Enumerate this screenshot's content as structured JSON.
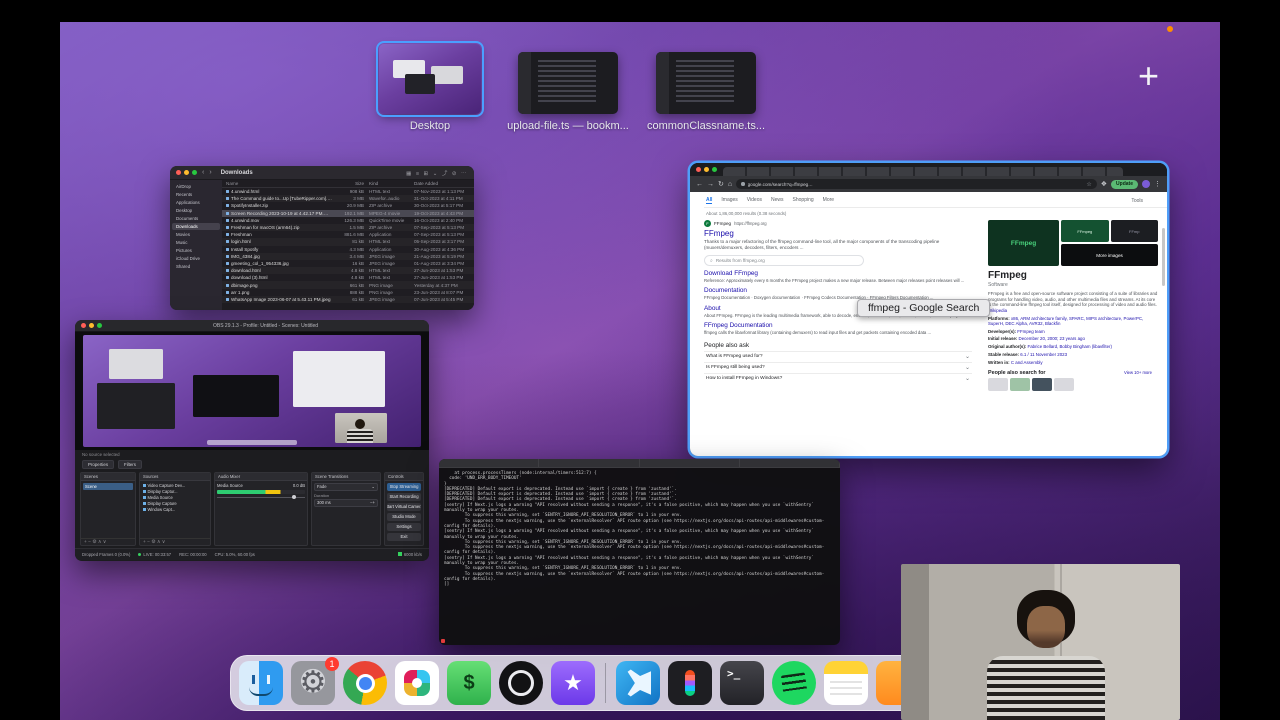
{
  "spaces": {
    "items": [
      {
        "id": "desktop",
        "label": "Desktop",
        "selected": true
      },
      {
        "id": "editor1",
        "label": "upload-file.ts — bookm...",
        "selected": false
      },
      {
        "id": "editor2",
        "label": "commonClassname.ts...",
        "selected": false
      }
    ],
    "add_label": "+"
  },
  "finder": {
    "title": "Downloads",
    "toolbar_icons": "▦ ≡ ⊞ ⌄ ⤴ ⊘ ⋯",
    "sidebar": [
      "AirDrop",
      "Recents",
      "Applications",
      "Desktop",
      "Documents",
      "Downloads",
      "Movies",
      "Music",
      "Pictures",
      "iCloud Drive",
      "Shared"
    ],
    "columns": [
      "Name",
      "Size",
      "Kind",
      "Date Added"
    ],
    "rows": [
      {
        "name": "4.unwind.html",
        "size": "908 kB",
        "kind": "HTML text",
        "date": "07-Nov-2023 at 1:13 PM"
      },
      {
        "name": "The Command guide to...Up [TubeRipper.com].wav",
        "size": "3 MB",
        "kind": "Wavefor..audio",
        "date": "31-Oct-2023 at 4:11 PM"
      },
      {
        "name": "SpotifyInstaller.zip",
        "size": "20.9 MB",
        "kind": "ZIP archive",
        "date": "30-Oct-2023 at 5:17 PM"
      },
      {
        "name": "Screen Recording 2023-10-19 at 4.42.17 PM.mp4",
        "size": "192.1 MB",
        "kind": "MPEG-4 movie",
        "date": "19-Oct-2023 at 4:43 PM"
      },
      {
        "name": "4.unwind.mov",
        "size": "126.3 MB",
        "kind": "QuickTime movie",
        "date": "16-Oct-2023 at 2:40 PM"
      },
      {
        "name": "Freshman for macOS (arm64).zip",
        "size": "1.5 MB",
        "kind": "ZIP archive",
        "date": "07-Sep-2023 at 5:13 PM"
      },
      {
        "name": "Freshman",
        "size": "881.6 MB",
        "kind": "Application",
        "date": "07-Sep-2023 at 5:13 PM"
      },
      {
        "name": "login.html",
        "size": "81 kB",
        "kind": "HTML text",
        "date": "05-Sep-2023 at 3:17 PM"
      },
      {
        "name": "Install Spotify",
        "size": "4.3 MB",
        "kind": "Application",
        "date": "30-Aug-2023 at 4:36 PM"
      },
      {
        "name": "IMG_4384.jpg",
        "size": "3.4 MB",
        "kind": "JPEG image",
        "date": "21-Aug-2023 at 5:19 PM"
      },
      {
        "name": "gmeeting_col_1_954336.jpg",
        "size": "16 kB",
        "kind": "JPEG image",
        "date": "01-Aug-2023 at 3:34 PM"
      },
      {
        "name": "download.html",
        "size": "4.8 kB",
        "kind": "HTML text",
        "date": "27-Jun-2023 at 1:53 PM"
      },
      {
        "name": "download (3).html",
        "size": "4.8 kB",
        "kind": "HTML text",
        "date": "27-Jun-2023 at 1:53 PM"
      },
      {
        "name": "dbimage.png",
        "size": "661 kB",
        "kind": "PNG image",
        "date": "Yesterday at 4:37 PM"
      },
      {
        "name": "arr 1.png",
        "size": "888 kB",
        "kind": "PNG image",
        "date": "23-Jun-2023 at 8:07 PM"
      },
      {
        "name": "WhatsApp Image 2023-06-07 at 5.43.11 PM.jpeg",
        "size": "61 kB",
        "kind": "JPEG image",
        "date": "07-Jun-2023 at 5:45 PM"
      }
    ]
  },
  "chrome": {
    "url": "google.com/search?q=ffmpeg…",
    "update_label": "Update",
    "tools_label": "Tools",
    "nav_tabs": [
      {
        "label": "All",
        "selected": true
      },
      {
        "label": "Images",
        "selected": false
      },
      {
        "label": "Videos",
        "selected": false
      },
      {
        "label": "News",
        "selected": false
      },
      {
        "label": "Shopping",
        "selected": false
      },
      {
        "label": "More",
        "selected": false
      }
    ],
    "stats": "About 1,86,00,000 results (0.38 seconds)",
    "main_result": {
      "favicon_letter": "F",
      "site": "FFmpeg",
      "url": "https://ffmpeg.org",
      "title": "FFmpeg",
      "snippet": "Thanks to a major refactoring of the ffmpeg command-line tool, all the major components of the transcoding pipeline (muxers/demuxers, decoders, filters, encoders ...",
      "site_search_placeholder": "Results from ffmpeg.org"
    },
    "sub_results": [
      {
        "title": "Download FFmpeg",
        "snippet": "Reference: Approximately every 6 months the FFmpeg project makes a new major release. Between major releases point releases will ..."
      },
      {
        "title": "Documentation",
        "snippet": "FFmpeg Documentation · Doxygen documentation · FFmpeg Codecs Documentation · FFmpeg Filters Documentation ..."
      },
      {
        "title": "About",
        "snippet": "About FFmpeg. FFmpeg is the leading multimedia framework, able to decode, encode, transcode, mux, demux, stream, filter and play ..."
      },
      {
        "title": "FFmpeg Documentation",
        "snippet": "ffmpeg calls the libavformat library (containing demuxers) to read input files and get packets containing encoded data ..."
      }
    ],
    "people_also_ask": {
      "title": "People also ask",
      "items": [
        "What is FFmpeg used for?",
        "Is FFmpeg still being used?",
        "How to install FFmpeg in Windows?"
      ]
    },
    "knowledge_panel": {
      "collage": {
        "tile1": "FFmpeg",
        "tile2": "FFmpeg",
        "tile3": "FFmp",
        "more": "More images"
      },
      "title": "FFmpeg",
      "subtitle": "Software",
      "description": "FFmpeg is a free and open-source software project consisting of a suite of libraries and programs for handling video, audio, and other multimedia files and streams. At its core is the command-line ffmpeg tool itself, designed for processing of video and audio files.",
      "wikipedia_label": "Wikipedia",
      "facts": [
        {
          "label": "Platforms:",
          "value": "x86, ARM architecture family, SPARC, MIPS architecture, PowerPC, SuperH, DEC Alpha, AVR32, Blackfin"
        },
        {
          "label": "Developer(s):",
          "value": "FFmpeg team"
        },
        {
          "label": "Initial release:",
          "value": "December 20, 2000; 23 years ago"
        },
        {
          "label": "Original author(s):",
          "value": "Fabrice Bellard, Bobby Bingham (libavfilter)"
        },
        {
          "label": "Stable release:",
          "value": "6.1 / 11 November 2023"
        },
        {
          "label": "Written in:",
          "value": "C and Assembly"
        }
      ],
      "pasf_label": "People also search for",
      "view_more": "View 10+ more"
    },
    "tooltip": "ffmpeg - Google Search"
  },
  "obs": {
    "title": "OBS 29.1.3 - Profile: Untitled - Scenes: Untitled",
    "no_source": "No source selected",
    "preview_buttons": [
      "Properties",
      "Filters"
    ],
    "panels": {
      "scenes": {
        "title": "Scenes",
        "items": [
          "Scene"
        ]
      },
      "sources": {
        "title": "Sources",
        "items": [
          "Video Capture Dev...",
          "Display Captur...",
          "Media Source",
          "Display Capture",
          "Window Capt..."
        ]
      },
      "mixer": {
        "title": "Audio Mixer",
        "channel": "Media Source",
        "db": "0.0 dB"
      },
      "transitions": {
        "title": "Scene Transitions",
        "transition": "Fade",
        "duration_label": "Duration",
        "duration": "300 ms"
      },
      "controls": {
        "title": "Controls",
        "buttons": [
          "Stop Streaming",
          "Start Recording",
          "Start Virtual Camera",
          "Studio Mode",
          "Settings",
          "Exit"
        ]
      }
    },
    "status": {
      "dropped": "Dropped Frames 0 (0.0%)",
      "live": "LIVE: 00:33:57",
      "rec": "REC: 00:00:00",
      "cpu": "CPU: 5.0%, 60.00 fps",
      "kbps": "6000 kb/s"
    },
    "footer_icons": "+ − ⚙ ∧ ∨"
  },
  "terminal": {
    "lines": [
      "    at process.processTimers (node:internal/timers:512:7) {",
      "  code: 'UND_ERR_BODY_TIMEOUT'",
      "}",
      "[DEPRECATED] Default export is deprecated. Instead use `import { create } from 'zustand'`.",
      "[DEPRECATED] Default export is deprecated. Instead use `import { create } from 'zustand'`.",
      "[DEPRECATED] Default export is deprecated. Instead use `import { create } from 'zustand'`.",
      "[sentry] If Next.js logs a warning \"API resolved without sending a response\", it's a false positive, which may happen when you use `withSentry` manually to wrap your routes.",
      "        To suppress this warning, set `SENTRY_IGNORE_API_RESOLUTION_ERROR` to 1 in your env.",
      "        To suppress the nextjs warning, use the `externalResolver` API route option (see https://nextjs.org/docs/api-routes/api-middlewares#custom-config for details).",
      "[sentry] If Next.js logs a warning \"API resolved without sending a response\", it's a false positive, which may happen when you use `withSentry` manually to wrap your routes.",
      "        To suppress this warning, set `SENTRY_IGNORE_API_RESOLUTION_ERROR` to 1 in your env.",
      "        To suppress the nextjs warning, use the `externalResolver` API route option (see https://nextjs.org/docs/api-routes/api-middlewares#custom-config for details).",
      "[sentry] If Next.js logs a warning \"API resolved without sending a response\", it's a false positive, which may happen when you use `withSentry` manually to wrap your routes.",
      "        To suppress this warning, set `SENTRY_IGNORE_API_RESOLUTION_ERROR` to 1 in your env.",
      "        To suppress the nextjs warning, use the `externalResolver` API route option (see https://nextjs.org/docs/api-routes/api-middlewares#custom-config for details).",
      "[]"
    ]
  },
  "dock": {
    "items": [
      {
        "icon": "finder-icon"
      },
      {
        "icon": "settings-icon",
        "badge": "1"
      },
      {
        "icon": "chrome-icon"
      },
      {
        "icon": "slack-icon"
      },
      {
        "icon": "iterm-icon"
      },
      {
        "icon": "obs-icon"
      },
      {
        "icon": "star-icon"
      },
      {
        "icon": "dock-separator"
      },
      {
        "icon": "vscode-icon"
      },
      {
        "icon": "figma-icon"
      },
      {
        "icon": "terminal-icon"
      },
      {
        "icon": "spotify-icon"
      },
      {
        "icon": "notes-icon"
      },
      {
        "icon": "orange-icon"
      }
    ]
  }
}
